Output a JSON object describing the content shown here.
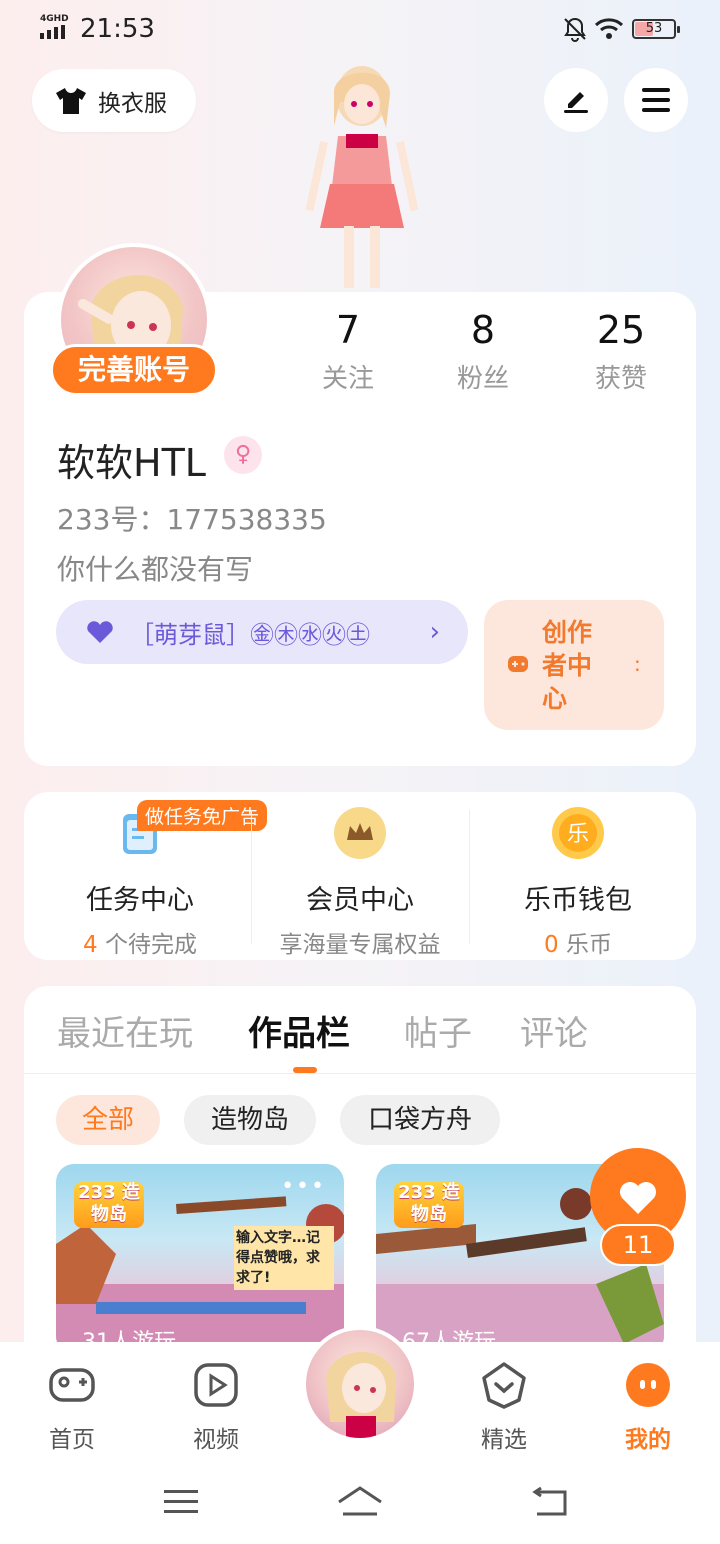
{
  "status_bar": {
    "network": "4GHD",
    "time": "21:53",
    "battery": "53"
  },
  "top": {
    "dress_label": "换衣服"
  },
  "profile": {
    "complete_label": "完善账号",
    "stats": [
      {
        "value": "7",
        "label": "关注"
      },
      {
        "value": "8",
        "label": "粉丝"
      },
      {
        "value": "25",
        "label": "获赞"
      }
    ],
    "username": "软软HTL",
    "gender_symbol": "♀",
    "uid": "233号：177538335",
    "bio": "你什么都没有写",
    "badge": {
      "text": "［萌芽鼠］㊎㊍㊌㊋㊏",
      "arrow": "›"
    },
    "creator": {
      "label": "创作者中心",
      "more": ":"
    }
  },
  "services": {
    "ad_tag": "做任务免广告",
    "items": [
      {
        "title": "任务中心",
        "count": "4",
        "sub": " 个待完成"
      },
      {
        "title": "会员中心",
        "count": "",
        "sub": "享海量专属权益"
      },
      {
        "title": "乐币钱包",
        "count": "0",
        "sub": " 乐币"
      }
    ],
    "coin_glyph": "乐"
  },
  "tabs": [
    "最近在玩",
    "作品栏",
    "帖子",
    "评论"
  ],
  "active_tab": "作品栏",
  "chips": [
    "全部",
    "造物岛",
    "口袋方舟"
  ],
  "games": [
    {
      "logo": "233 造物岛",
      "plays": "31人游玩",
      "caption": "输入文字…记得点赞哦，求求了!"
    },
    {
      "logo": "233 造物岛",
      "plays": "67人游玩",
      "caption": ""
    }
  ],
  "like_count": "11",
  "bottom_nav": [
    {
      "label": "首页",
      "icon": "gamepad-icon"
    },
    {
      "label": "视频",
      "icon": "play-icon"
    },
    {
      "label": "精选",
      "icon": "heart-chat-icon"
    },
    {
      "label": "我的",
      "icon": "dots-icon"
    }
  ],
  "colors": {
    "accent": "#ff7a1f",
    "badge_purple": "#6a5ad9"
  }
}
